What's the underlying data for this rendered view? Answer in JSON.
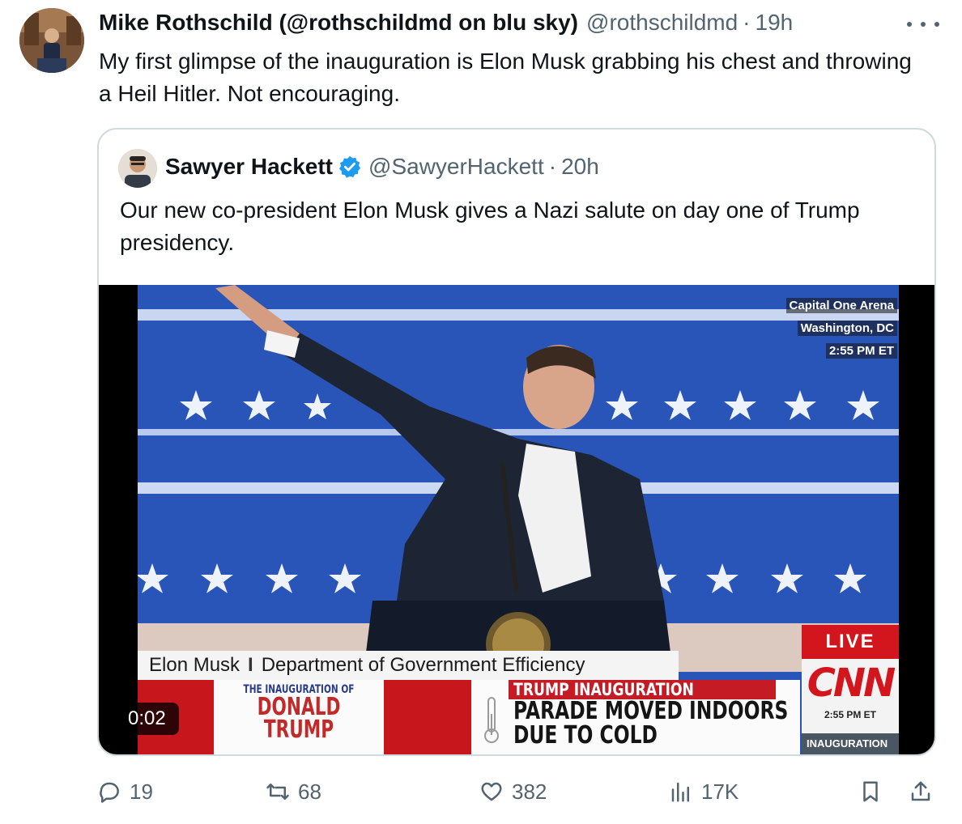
{
  "tweet": {
    "display_name": "Mike Rothschild (@rothschildmd on blu sky)",
    "handle": "@rothschildmd",
    "separator": "·",
    "time": "19h",
    "text": "My first glimpse of the inauguration is Elon Musk grabbing his chest and throwing a Heil Hitler. Not encouraging."
  },
  "quote": {
    "display_name": "Sawyer Hackett",
    "handle": "@SawyerHackett",
    "separator": "·",
    "time": "20h",
    "text": "Our new co-president Elon Musk gives a Nazi salute on day one of Trump presidency.",
    "verified": true
  },
  "video": {
    "duration": "0:02",
    "location_lines": [
      "Capital One Arena",
      "Washington, DC",
      "2:55 PM ET"
    ],
    "lower_third_name": "Elon Musk",
    "lower_third_sep": "I",
    "lower_third_title": "Department of Government Efficiency",
    "logo_small": "THE INAUGURATION OF",
    "logo_line1": "DONALD",
    "logo_line2": "TRUMP",
    "ticker_label": "TRUMP INAUGURATION",
    "ticker_line1": "PARADE MOVED INDOORS",
    "ticker_line2": "DUE TO COLD",
    "live": "LIVE",
    "network": "CNN",
    "network_time": "2:55 PM ET",
    "network_tag": "INAUGURATION"
  },
  "actions": {
    "replies": "19",
    "reposts": "68",
    "likes": "382",
    "views": "17K"
  },
  "colors": {
    "text_primary": "#0f1419",
    "text_secondary": "#536471",
    "border": "#cfd9de",
    "verified": "#1d9bf0",
    "cnn_red": "#d3151d"
  }
}
